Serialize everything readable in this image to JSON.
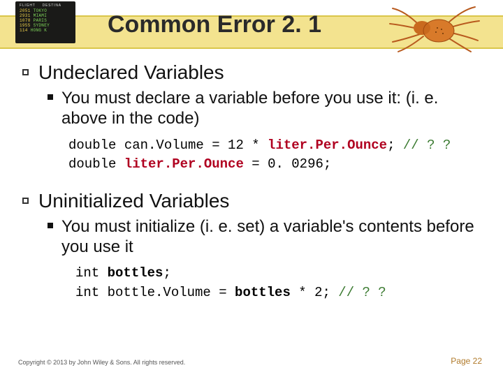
{
  "title": "Common Error 2. 1",
  "sections": [
    {
      "heading": "Undeclared Variables",
      "sub": "You must declare a variable before you use it: (i. e. above in the code)",
      "code": [
        {
          "plain": "double can.Volume = 12 * ",
          "err": "liter.Per.Ounce",
          "tail": "; ",
          "comment": "// ? ?"
        },
        {
          "plain": "double ",
          "err": "liter.Per.Ounce",
          "tail": " = 0. 0296;",
          "comment": ""
        }
      ]
    },
    {
      "heading": "Uninitialized Variables",
      "sub": "You must initialize (i. e. set) a variable's contents before you use it",
      "code": [
        {
          "plain": "int ",
          "bold": "bottles",
          "tail": ";",
          "comment": ""
        },
        {
          "plain": "int bottle.Volume = ",
          "bold": "bottles",
          "tail": " * 2;   ",
          "comment": "// ? ?"
        }
      ]
    }
  ],
  "footer": {
    "copyright": "Copyright © 2013 by John Wiley & Sons. All rights reserved.",
    "page": "Page 22"
  },
  "board": {
    "head1": "FLIGHT",
    "head2": "DESTINA",
    "rows": [
      [
        "2051",
        "TOKYO"
      ],
      [
        "2931",
        "MIAMI"
      ],
      [
        "1078",
        "PARIS"
      ],
      [
        "1955",
        "SYDNEY"
      ],
      [
        "114",
        "HONG K"
      ]
    ]
  }
}
